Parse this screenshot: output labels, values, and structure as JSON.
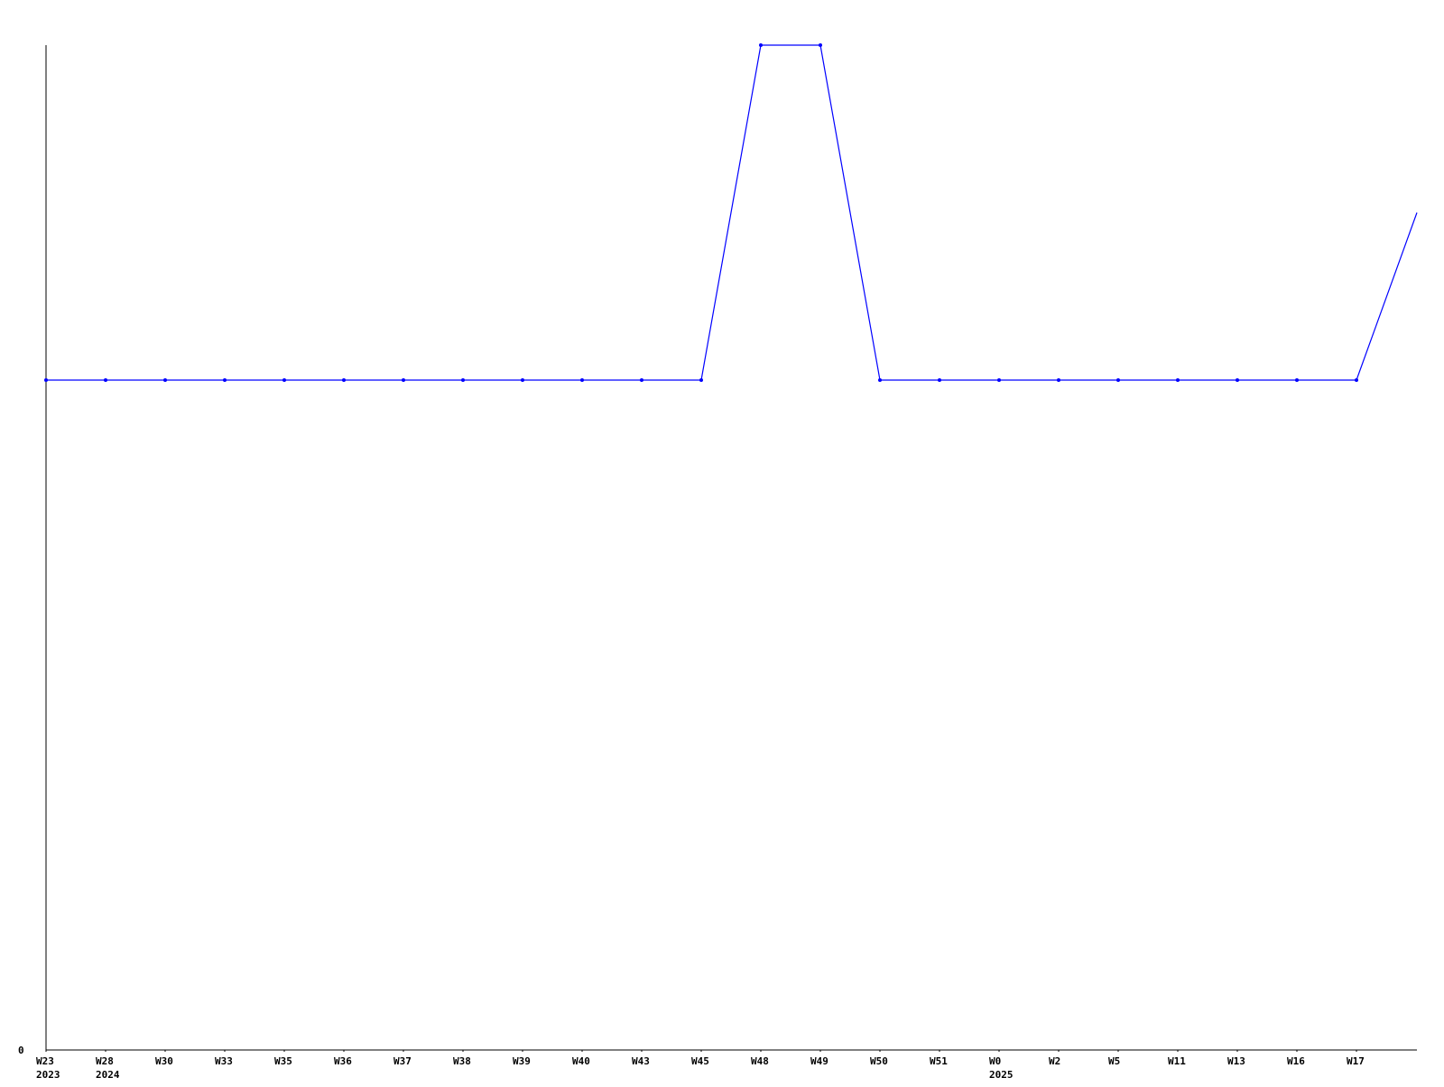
{
  "chart_data": {
    "type": "line",
    "title": "",
    "xlabel": "",
    "ylabel": "",
    "categories": [
      "W23",
      "W28",
      "W30",
      "W33",
      "W35",
      "W36",
      "W37",
      "W38",
      "W39",
      "W40",
      "W43",
      "W45",
      "W48",
      "W49",
      "W50",
      "W51",
      "W0",
      "W2",
      "W5",
      "W11",
      "W13",
      "W16",
      "W17"
    ],
    "year_labels": [
      {
        "category": "W23",
        "year": "2023"
      },
      {
        "category": "W28",
        "year": "2024"
      },
      {
        "category": "W0",
        "year": "2025"
      }
    ],
    "y_tick_labels": [
      {
        "value": 0,
        "label": "0"
      }
    ],
    "ylim": [
      0,
      1.5
    ],
    "series": [
      {
        "values": [
          1,
          1,
          1,
          1,
          1,
          1,
          1,
          1,
          1,
          1,
          1,
          1,
          1.5,
          1.5,
          1,
          1,
          1,
          1,
          1,
          1,
          1,
          1,
          1
        ],
        "trailing_value": 1.25
      }
    ],
    "line_color": "#0000ff",
    "axis_color": "#000000",
    "grid": false,
    "legend": "none"
  }
}
